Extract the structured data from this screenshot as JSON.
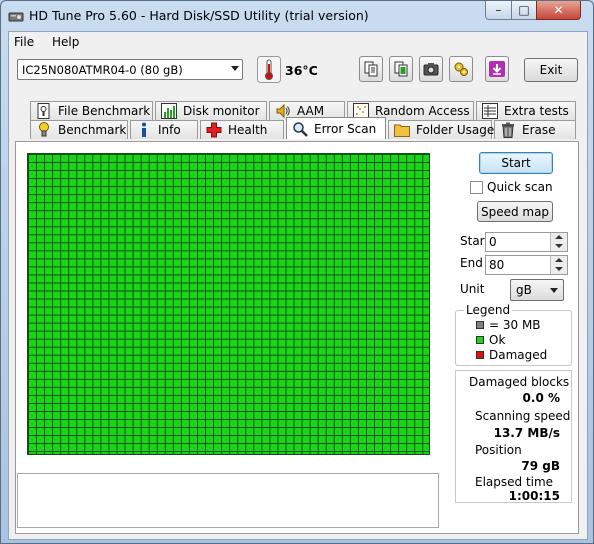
{
  "window": {
    "title": "HD Tune Pro 5.60 - Hard Disk/SSD Utility (trial version)",
    "controls": {
      "minimize": "–",
      "maximize": "□",
      "close": "✕"
    }
  },
  "menu": {
    "items": [
      "File",
      "Help"
    ]
  },
  "toolbar": {
    "drive": "IC25N080ATMR04-0 (80 gB)",
    "temperature": "36°C",
    "icons": [
      "copy-text-icon",
      "copy-screenshot-icon",
      "camera-icon",
      "options-icon",
      "save-download-icon"
    ],
    "exit_label": "Exit"
  },
  "tabs": {
    "row1": [
      {
        "label": "File Benchmark",
        "icon": "file-benchmark-icon"
      },
      {
        "label": "Disk monitor",
        "icon": "disk-monitor-icon"
      },
      {
        "label": "AAM",
        "icon": "speaker-icon"
      },
      {
        "label": "Random Access",
        "icon": "random-access-icon"
      },
      {
        "label": "Extra tests",
        "icon": "extra-tests-icon"
      }
    ],
    "row2": [
      {
        "label": "Benchmark",
        "icon": "benchmark-icon"
      },
      {
        "label": "Info",
        "icon": "info-icon"
      },
      {
        "label": "Health",
        "icon": "health-cross-icon"
      },
      {
        "label": "Error Scan",
        "icon": "error-scan-icon",
        "active": true
      },
      {
        "label": "Folder Usage",
        "icon": "folder-icon"
      },
      {
        "label": "Erase",
        "icon": "trash-icon"
      }
    ]
  },
  "error_scan": {
    "grid": {
      "block_state": "Ok",
      "block_color": "#1ad41a",
      "damaged_blocks": 0
    },
    "start_button": "Start",
    "quick_scan_label": "Quick scan",
    "quick_scan_checked": false,
    "speed_map_button": "Speed map",
    "start_label": "Start",
    "start_value": "0",
    "end_label": "End",
    "end_value": "80",
    "unit_label": "Unit",
    "unit_value": "gB",
    "legend": {
      "title": "Legend",
      "items": [
        {
          "label": "= 30 MB",
          "color": "#808080"
        },
        {
          "label": "Ok",
          "color": "#1ad41a"
        },
        {
          "label": "Damaged",
          "color": "#e01010"
        }
      ]
    },
    "stats": {
      "damaged_blocks_label": "Damaged blocks",
      "damaged_blocks_value": "0.0 %",
      "scanning_speed_label": "Scanning speed",
      "scanning_speed_value": "13.7 MB/s",
      "position_label": "Position",
      "position_value": "79 gB",
      "elapsed_label": "Elapsed time",
      "elapsed_value": "1:00:15"
    }
  }
}
